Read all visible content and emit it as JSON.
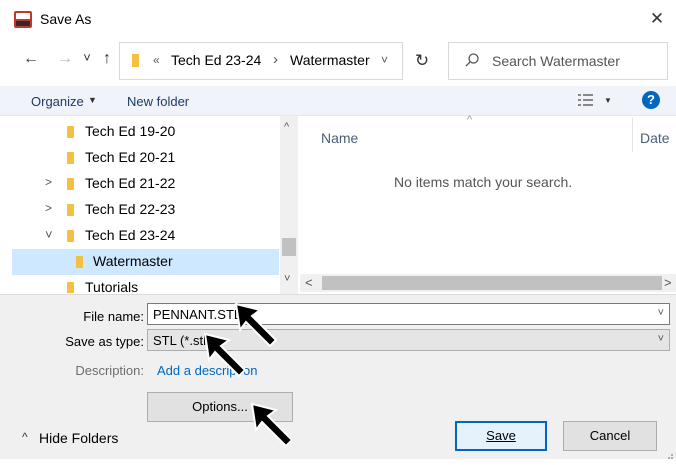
{
  "window": {
    "title": "Save As"
  },
  "nav": {
    "back_glyph": "←",
    "forward_glyph": "→",
    "recent_glyph": "˅",
    "up_glyph": "↑",
    "breadcrumb_sep_start": "«",
    "breadcrumb": [
      "Tech Ed 23-24",
      "Watermaster"
    ],
    "breadcrumb_sep": "›",
    "refresh_glyph": "↻",
    "search_placeholder": "Search Watermaster"
  },
  "commands": {
    "organize": "Organize",
    "new_folder": "New folder",
    "help": "?"
  },
  "tree": [
    {
      "label": "Tech Ed 19-20",
      "chevron": ""
    },
    {
      "label": "Tech Ed 20-21",
      "chevron": ""
    },
    {
      "label": "Tech Ed 21-22",
      "chevron": ">"
    },
    {
      "label": "Tech Ed 22-23",
      "chevron": ">"
    },
    {
      "label": "Tech Ed 23-24",
      "chevron": "˅"
    },
    {
      "label": "Watermaster",
      "chevron": "",
      "selected": true
    },
    {
      "label": "Tutorials",
      "chevron": ""
    }
  ],
  "content": {
    "columns": [
      "Name",
      "Date"
    ],
    "empty_message": "No items match your search."
  },
  "form": {
    "file_name_label": "File name:",
    "file_name_value": "PENNANT.STL",
    "save_type_label": "Save as type:",
    "save_type_value": "STL (*.stl)",
    "description_label": "Description:",
    "description_link": "Add a description",
    "options_button": "Options...",
    "hide_folders": "Hide Folders",
    "save_button": "Save",
    "cancel_button": "Cancel"
  },
  "colors": {
    "accent": "#0067c0",
    "selection": "#cde8ff",
    "folder": "#f3c13f",
    "panel": "#f0f0f0"
  }
}
